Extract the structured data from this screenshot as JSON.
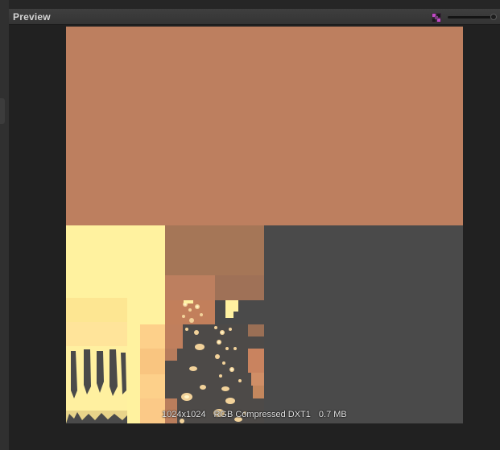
{
  "panel": {
    "title": "Preview"
  },
  "header": {
    "mode_icon": "rgb-channel-icon",
    "slider_level": 1.0
  },
  "texture": {
    "resolution": "1024x1024",
    "format": "RGB Compressed DXT1",
    "size": "0.7 MB",
    "colors": {
      "base": "#bd7f5f",
      "mip_background": "#4a4a4a",
      "yellow": "#ffef9a",
      "tan": "#a57657"
    }
  }
}
